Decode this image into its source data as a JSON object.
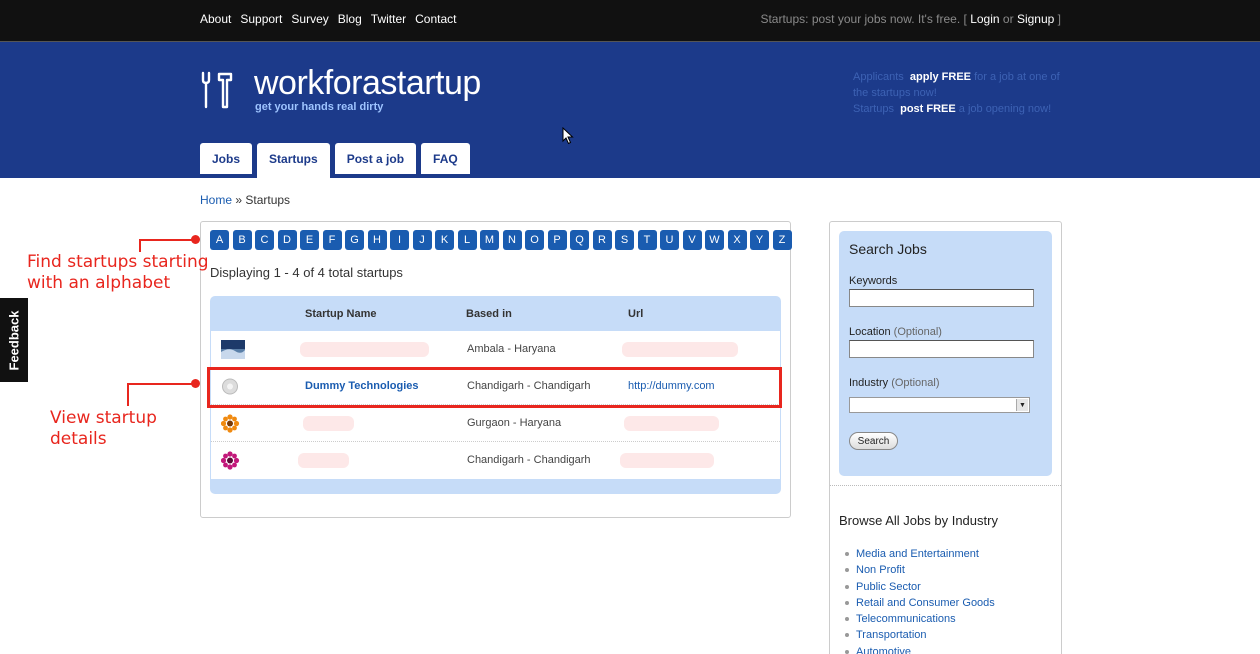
{
  "topnav": {
    "links": [
      "About",
      "Support",
      "Survey",
      "Blog",
      "Twitter",
      "Contact"
    ],
    "right_text": "Startups: post your jobs now. It's free. [",
    "login": "Login",
    "or": "or",
    "signup": "Signup",
    "close_bracket": "]"
  },
  "header": {
    "brand": "workforastartup",
    "tagline": "get your hands real dirty",
    "promo": {
      "line1_prefix": "Applicants",
      "line1_bold": "apply FREE",
      "line1_suffix": "for a job at one of the startups now!",
      "line2_prefix": "Startups",
      "line2_bold": "post FREE",
      "line2_suffix": "a job opening now!"
    },
    "tabs": [
      {
        "label": "Jobs",
        "active": false
      },
      {
        "label": "Startups",
        "active": true
      },
      {
        "label": "Post a job",
        "active": false
      },
      {
        "label": "FAQ",
        "active": false
      }
    ]
  },
  "breadcrumb": {
    "home": "Home",
    "separator": " » ",
    "current": "Startups"
  },
  "main": {
    "letters": [
      "A",
      "B",
      "C",
      "D",
      "E",
      "F",
      "G",
      "H",
      "I",
      "J",
      "K",
      "L",
      "M",
      "N",
      "O",
      "P",
      "Q",
      "R",
      "S",
      "T",
      "U",
      "V",
      "W",
      "X",
      "Y",
      "Z"
    ],
    "displaying": "Displaying 1 - 4 of 4 total startups",
    "columns": [
      "Startup Name",
      "Based in",
      "Url"
    ],
    "rows": [
      {
        "name": "",
        "based_in": "Ambala - Haryana",
        "url": "",
        "thumb": "landscape-thumbnail"
      },
      {
        "name": "Dummy Technologies",
        "based_in": "Chandigarh - Chandigarh",
        "url": "http://dummy.com",
        "thumb": "flower-white-thumbnail"
      },
      {
        "name": "",
        "based_in": "Gurgaon - Haryana",
        "url": "",
        "thumb": "flower-orange-thumbnail"
      },
      {
        "name": "",
        "based_in": "Chandigarh - Chandigarh",
        "url": "",
        "thumb": "flower-pink-thumbnail"
      }
    ]
  },
  "annotations": {
    "alphabet": "Find startups starting with an alphabet",
    "details": "View startup details"
  },
  "feedback": "Feedback",
  "sidebar": {
    "search_title": "Search Jobs",
    "keywords_label": "Keywords",
    "location_label": "Location",
    "location_optional": "(Optional)",
    "industry_label": "Industry",
    "industry_optional": "(Optional)",
    "industry_selected": "",
    "search_button": "Search",
    "browse_title": "Browse All Jobs by Industry",
    "industries": [
      "Media and Entertainment",
      "Non Profit",
      "Public Sector",
      "Retail and Consumer Goods",
      "Telecommunications",
      "Transportation",
      "Automotive"
    ]
  },
  "colors": {
    "header_blue": "#1c3a8a",
    "link_blue": "#1a5cb0",
    "annotation_red": "#e8261e",
    "table_blue": "#c6dcf8"
  }
}
